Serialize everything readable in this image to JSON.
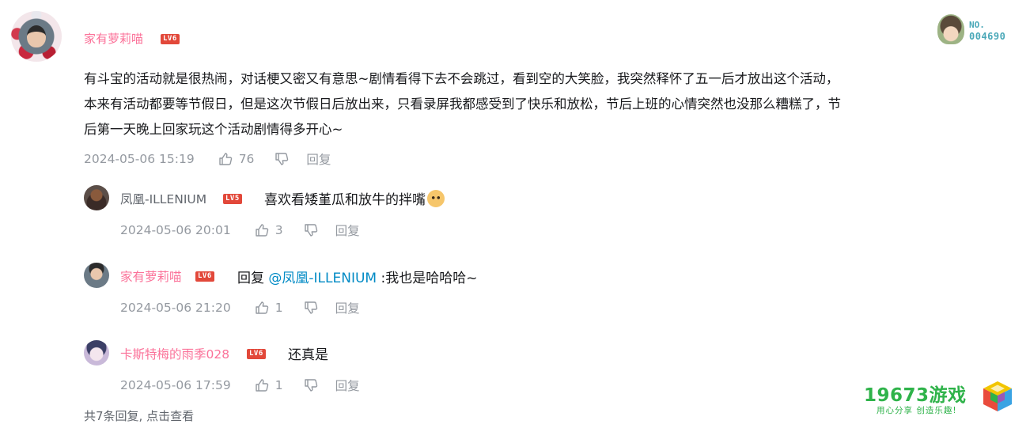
{
  "main_comment": {
    "username": "家有萝莉喵",
    "level": "LV6",
    "text": "有斗宝的活动就是很热闹，对话梗又密又有意思~剧情看得下去不会跳过，看到空的大笑脸，我突然释怀了五一后才放出这个活动，\n本来有活动都要等节假日，但是这次节假日后放出来，只看录屏我都感受到了快乐和放松，节后上班的心情突然也没那么糟糕了，节\n后第一天晚上回家玩这个活动剧情得多开心~",
    "time": "2024-05-06 15:19",
    "likes": "76",
    "reply_label": "回复",
    "badge": {
      "line1": "NO.",
      "line2": "004690"
    }
  },
  "replies": [
    {
      "username": "凤凰-ILLENIUM",
      "level": "LV5",
      "text": "喜欢看矮堇瓜和放牛的拌嘴",
      "time": "2024-05-06 20:01",
      "likes": "3",
      "reply_label": "回复"
    },
    {
      "username": "家有萝莉喵",
      "level": "LV6",
      "prefix": "回复 ",
      "mention": "@凤凰-ILLENIUM",
      "text": " :我也是哈哈哈~",
      "time": "2024-05-06 21:20",
      "likes": "1",
      "reply_label": "回复"
    },
    {
      "username": "卡斯特梅的雨季028",
      "level": "LV6",
      "text": "还真是",
      "time": "2024-05-06 17:59",
      "likes": "1",
      "reply_label": "回复"
    }
  ],
  "footer": {
    "text": "共7条回复, 点击查看"
  },
  "watermark": {
    "brand": "19673游戏",
    "slogan": "用心分享 创造乐趣!"
  },
  "colors": {
    "username_pink": "#fb7299",
    "mention_blue": "#008ac5",
    "meta_gray": "#9499a0",
    "brand_green": "#2fb34a",
    "level_red": "#e2483a"
  },
  "icons": [
    "like-icon",
    "dislike-icon",
    "emoji-icon"
  ]
}
